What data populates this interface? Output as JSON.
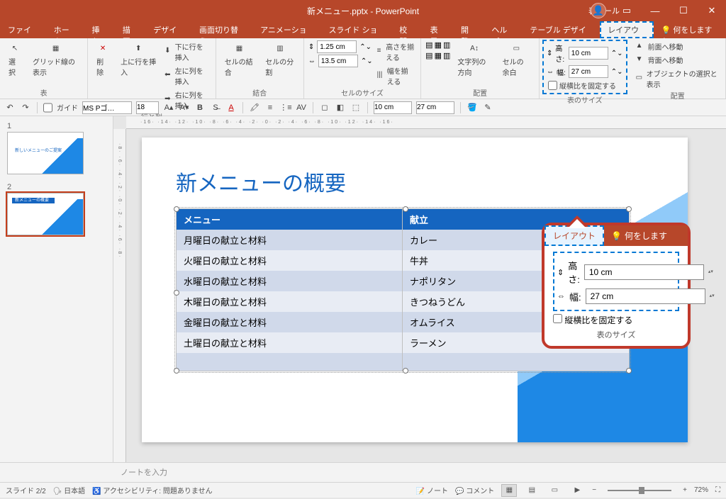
{
  "titlebar": {
    "file": "新メニュー.pptx",
    "app": "PowerPoint",
    "context": "表ツール"
  },
  "tabs": [
    "ファイル",
    "ホーム",
    "挿入",
    "描画",
    "デザイン",
    "画面切り替え",
    "アニメーション",
    "スライド ショー",
    "校閲",
    "表示",
    "開発",
    "ヘルプ",
    "テーブル デザイン",
    "レイアウト"
  ],
  "tellme": "何をしますか",
  "ribbon": {
    "g1": {
      "label": "表",
      "select": "選択",
      "grid": "グリッド線の表示"
    },
    "g2": {
      "label": "行と列",
      "delete": "削除",
      "insAbove": "上に行を挿入",
      "insBelow": "下に行を挿入",
      "insLeft": "左に列を挿入",
      "insRight": "右に列を挿入"
    },
    "g3": {
      "label": "結合",
      "merge": "セルの結合",
      "split": "セルの分割"
    },
    "g4": {
      "label": "セルのサイズ",
      "h": "1.25 cm",
      "w": "13.5 cm",
      "distH": "高さを揃える",
      "distW": "幅を揃える"
    },
    "g5": {
      "label": "配置",
      "textDir": "文字列の方向",
      "margin": "セルの余白"
    },
    "g6": {
      "label": "表のサイズ",
      "hLbl": "高さ:",
      "wLbl": "幅:",
      "h": "10 cm",
      "w": "27 cm",
      "lock": "縦横比を固定する"
    },
    "g7": {
      "label": "配置",
      "front": "前面へ移動",
      "back": "背面へ移動",
      "pane": "オブジェクトの選択と表示"
    }
  },
  "qat": {
    "guide": "ガイド",
    "font": "MS Pゴ…",
    "size": "18",
    "h": "10 cm",
    "w": "27 cm"
  },
  "slide": {
    "title": "新メニューの概要",
    "headers": [
      "メニュー",
      "献立"
    ],
    "rows": [
      [
        "月曜日の献立と材料",
        "カレー"
      ],
      [
        "火曜日の献立と材料",
        "牛丼"
      ],
      [
        "水曜日の献立と材料",
        "ナポリタン"
      ],
      [
        "木曜日の献立と材料",
        "きつねうどん"
      ],
      [
        "金曜日の献立と材料",
        "オムライス"
      ],
      [
        "土曜日の献立と材料",
        "ラーメン"
      ]
    ],
    "thumb1": "新しいメニューのご提案",
    "thumb2": "新メニューの概要"
  },
  "callout": {
    "tab": "レイアウト",
    "tell": "何をします",
    "hLbl": "高さ:",
    "wLbl": "幅:",
    "h": "10 cm",
    "w": "27 cm",
    "lock": "縦横比を固定する",
    "grp": "表のサイズ"
  },
  "notes": "ノートを入力",
  "status": {
    "slide": "スライド 2/2",
    "lang": "日本語",
    "a11y": "アクセシビリティ: 問題ありません",
    "notes": "ノート",
    "comment": "コメント",
    "zoom": "72%"
  },
  "rulerH": "·16· ·14· ·12· ·10· ·8· ·6· ·4· ·2· ·0· ·2· ·4· ·6· ·8· ·10· ·12· ·14· ·16·",
  "rulerV": "·8· ·6· ·4· ·2· ·0· ·2· ·4· ·6· ·8·"
}
